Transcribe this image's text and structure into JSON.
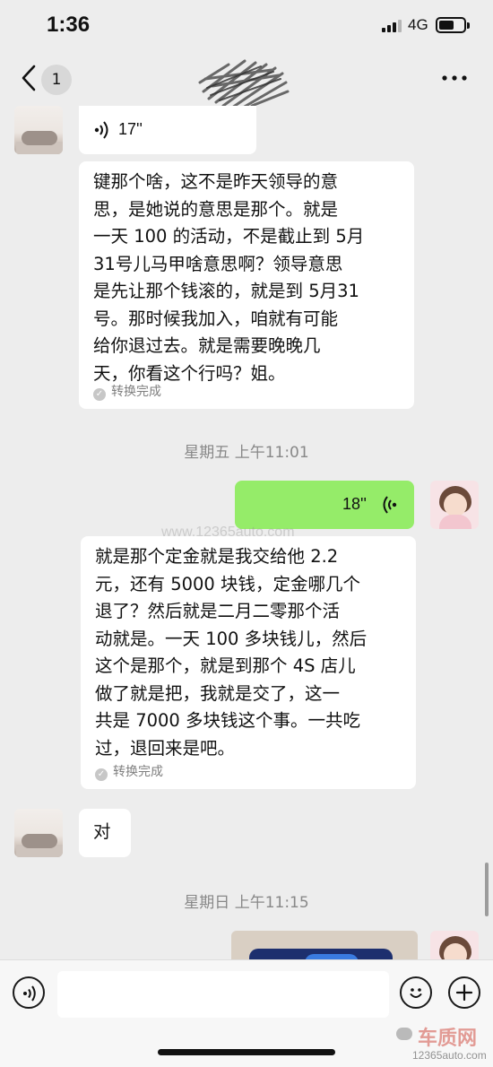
{
  "status_bar": {
    "time": "1:36",
    "network": "4G"
  },
  "nav": {
    "unread_count": "1"
  },
  "watermark": {
    "text": "www.12365auto.com"
  },
  "messages": [
    {
      "id": "m1",
      "side": "left",
      "type": "voice",
      "duration": "17''"
    },
    {
      "id": "m2",
      "side": "left",
      "type": "voice-text",
      "lines": [
        "键那个啥，这不是昨天领导的意",
        "思，是她说的意思是那个。就是",
        "一天 100 的活动，不是截止到 5月",
        "31号儿马甲啥意思啊？领导意思",
        "是先让那个钱滚的，就是到 5月31",
        "号。那时候我加入，咱就有可能",
        "给你退过去。就是需要晚晚几",
        "天，你看这个行吗？姐。"
      ],
      "status": "转换完成"
    },
    {
      "id": "t1",
      "type": "timestamp",
      "text": "星期五 上午11:01"
    },
    {
      "id": "m3",
      "side": "right",
      "type": "voice",
      "duration": "18''"
    },
    {
      "id": "m4",
      "side": "left",
      "type": "voice-text",
      "lines": [
        "就是那个定金就是我交给他 2.2",
        "元，还有 5000 块钱，定金哪几个",
        "退了？然后就是二月二零那个活",
        "动就是。一天 100 多块钱儿，然后",
        "这个是那个，就是到那个 4S 店儿",
        "做了就是把，我就是交了，这一",
        "共是 7000 多块钱这个事。一共吃",
        "过，退回来是吧。"
      ],
      "status": "转换完成"
    },
    {
      "id": "m5",
      "side": "left",
      "type": "text",
      "text": "对"
    },
    {
      "id": "t2",
      "type": "timestamp",
      "text": "星期日 上午11:15"
    },
    {
      "id": "m6",
      "side": "right",
      "type": "image"
    }
  ],
  "input_bar": {
    "placeholder": ""
  },
  "brand_watermark": {
    "name": "车质网",
    "url": "12365auto.com"
  },
  "icons": {
    "back": "chevron-left-icon",
    "more": "more-dots-icon",
    "voice_message": "voice-wave-icon",
    "voice_input": "voice-input-icon",
    "emoji": "emoji-icon",
    "plus": "plus-icon",
    "check": "check-icon"
  },
  "colors": {
    "background": "#ededed",
    "bubble_left": "#ffffff",
    "bubble_right": "#95ec69"
  }
}
